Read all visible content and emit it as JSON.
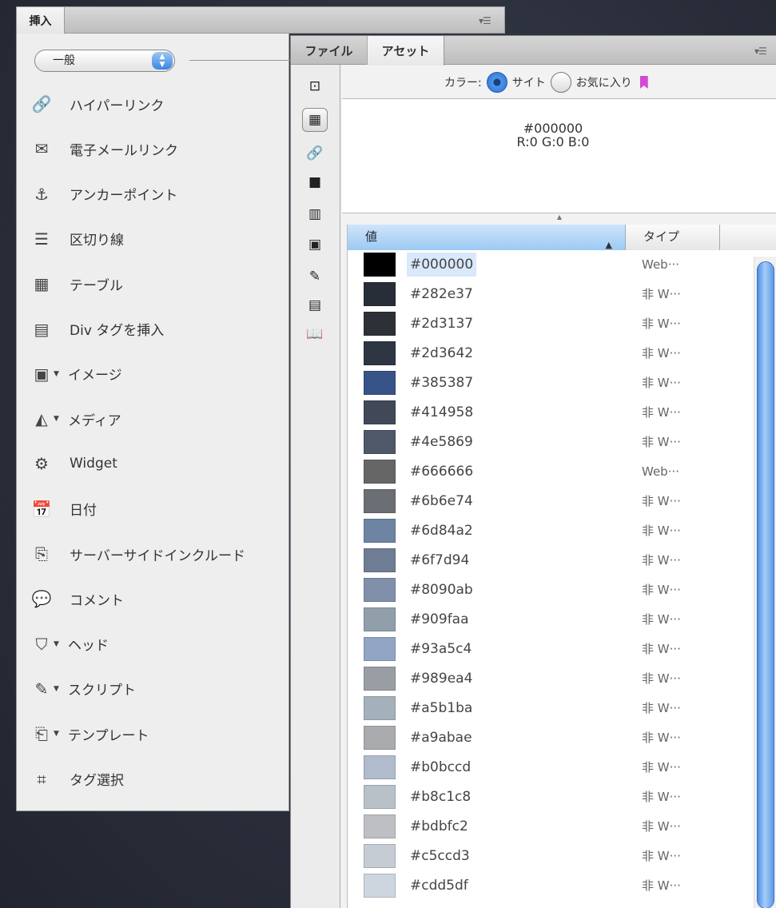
{
  "insert_panel": {
    "tab_label": "挿入",
    "menu_glyph": "▾☰",
    "category": "一般",
    "items": [
      {
        "label": "ハイパーリンク",
        "icon": "hyperlink-icon",
        "glyph": "🔗",
        "dropdown": false
      },
      {
        "label": "電子メールリンク",
        "icon": "email-link-icon",
        "glyph": "✉",
        "dropdown": false
      },
      {
        "label": "アンカーポイント",
        "icon": "anchor-icon",
        "glyph": "⚓",
        "dropdown": false
      },
      {
        "label": "区切り線",
        "icon": "horizontal-rule-icon",
        "glyph": "☰",
        "dropdown": false
      },
      {
        "label": "テーブル",
        "icon": "table-icon",
        "glyph": "▦",
        "dropdown": false
      },
      {
        "label": "Div タグを挿入",
        "icon": "div-tag-icon",
        "glyph": "▤",
        "dropdown": false
      },
      {
        "label": "イメージ",
        "icon": "image-icon",
        "glyph": "▣",
        "dropdown": true
      },
      {
        "label": "メディア",
        "icon": "media-icon",
        "glyph": "◭",
        "dropdown": true
      },
      {
        "label": "Widget",
        "icon": "widget-gear-icon",
        "glyph": "⚙",
        "dropdown": false
      },
      {
        "label": "日付",
        "icon": "calendar-icon",
        "glyph": "📅",
        "dropdown": false
      },
      {
        "label": "サーバーサイドインクルード",
        "icon": "server-include-icon",
        "glyph": "⎘",
        "dropdown": false
      },
      {
        "label": "コメント",
        "icon": "comment-icon",
        "glyph": "💬",
        "dropdown": false
      },
      {
        "label": "ヘッド",
        "icon": "head-icon",
        "glyph": "⛉",
        "dropdown": true
      },
      {
        "label": "スクリプト",
        "icon": "script-icon",
        "glyph": "✎",
        "dropdown": true
      },
      {
        "label": "テンプレート",
        "icon": "template-icon",
        "glyph": "⎗",
        "dropdown": true
      },
      {
        "label": "タグ選択",
        "icon": "tag-chooser-icon",
        "glyph": "⌗",
        "dropdown": false
      }
    ]
  },
  "assets_panel": {
    "tabs": [
      "ファイル",
      "アセット"
    ],
    "menu_glyph": "▾☰",
    "sidebar_icons": [
      {
        "name": "images-category-icon",
        "glyph": "⊡"
      },
      {
        "name": "colors-category-icon",
        "glyph": "▦"
      },
      {
        "name": "urls-category-icon",
        "glyph": "🔗"
      },
      {
        "name": "media-category-icon",
        "glyph": "■"
      },
      {
        "name": "video-category-icon",
        "glyph": "▥"
      },
      {
        "name": "movies-category-icon",
        "glyph": "▣"
      },
      {
        "name": "scripts-category-icon",
        "glyph": "✎"
      },
      {
        "name": "templates-category-icon",
        "glyph": "▤"
      },
      {
        "name": "library-category-icon",
        "glyph": "📖"
      }
    ],
    "color_label": "カラー:",
    "option_site": "サイト",
    "option_favorites": "お気に入り",
    "preview_hex": "#000000",
    "preview_rgb": "R:0 G:0 B:0",
    "columns": {
      "value": "値",
      "type": "タイプ"
    },
    "colors": [
      {
        "hex": "#000000",
        "type": "Web···",
        "selected": true
      },
      {
        "hex": "#282e37",
        "type": "非 W···"
      },
      {
        "hex": "#2d3137",
        "type": "非 W···"
      },
      {
        "hex": "#2d3642",
        "type": "非 W···"
      },
      {
        "hex": "#385387",
        "type": "非 W···"
      },
      {
        "hex": "#414958",
        "type": "非 W···"
      },
      {
        "hex": "#4e5869",
        "type": "非 W···"
      },
      {
        "hex": "#666666",
        "type": "Web···"
      },
      {
        "hex": "#6b6e74",
        "type": "非 W···"
      },
      {
        "hex": "#6d84a2",
        "type": "非 W···"
      },
      {
        "hex": "#6f7d94",
        "type": "非 W···"
      },
      {
        "hex": "#8090ab",
        "type": "非 W···"
      },
      {
        "hex": "#909faa",
        "type": "非 W···"
      },
      {
        "hex": "#93a5c4",
        "type": "非 W···"
      },
      {
        "hex": "#989ea4",
        "type": "非 W···"
      },
      {
        "hex": "#a5b1ba",
        "type": "非 W···"
      },
      {
        "hex": "#a9abae",
        "type": "非 W···"
      },
      {
        "hex": "#b0bccd",
        "type": "非 W···"
      },
      {
        "hex": "#b8c1c8",
        "type": "非 W···"
      },
      {
        "hex": "#bdbfc2",
        "type": "非 W···"
      },
      {
        "hex": "#c5ccd3",
        "type": "非 W···"
      },
      {
        "hex": "#cdd5df",
        "type": "非 W···"
      }
    ]
  }
}
